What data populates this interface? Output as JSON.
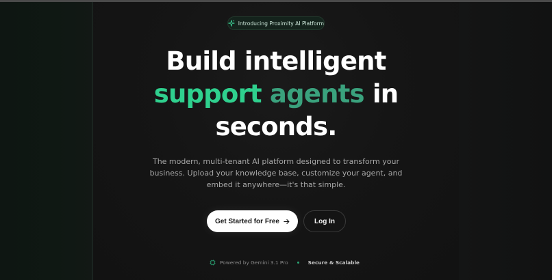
{
  "badge": {
    "label": "Introducing Proximity AI Platform",
    "icon": "sparkles-icon"
  },
  "hero": {
    "line1": "Build intelligent",
    "line2_highlight_a": "support",
    "line2_highlight_b": "agents",
    "line2_suffix": "in",
    "line3": "seconds.",
    "subtitle": "The modern, multi-tenant AI platform designed to transform your business. Upload your knowledge base, customize your agent, and embed it anywhere—it's that simple."
  },
  "actions": {
    "primary_label": "Get Started for Free",
    "primary_icon": "arrow-right-icon",
    "secondary_label": "Log In"
  },
  "footer": {
    "powered_by": "Powered by Gemini 3.1 Pro",
    "powered_icon": "cpu-icon",
    "secure": "Secure & Scalable"
  },
  "colors": {
    "accent": "#2fd08e",
    "accent_dark": "#3aa27d",
    "background": "#121212"
  }
}
